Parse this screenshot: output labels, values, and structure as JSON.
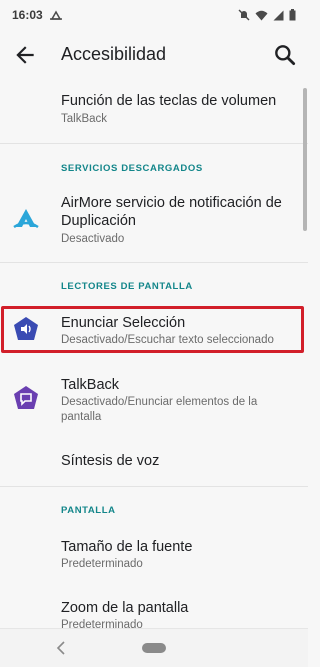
{
  "status_bar": {
    "time": "16:03"
  },
  "app_bar": {
    "title": "Accesibilidad"
  },
  "items": {
    "volume_keys": {
      "title": "Función de las teclas de volumen",
      "subtitle": "TalkBack"
    },
    "airmore": {
      "title_line1": "AirMore servicio de notificación de",
      "title_line2": "Duplicación",
      "subtitle": "Desactivado"
    },
    "enunciar": {
      "title": "Enunciar Selección",
      "subtitle": "Desactivado/Escuchar texto seleccionado"
    },
    "talkback": {
      "title": "TalkBack",
      "subtitle_line1": "Desactivado/Enunciar elementos de la",
      "subtitle_line2": "pantalla"
    },
    "tts": {
      "title": "Síntesis de voz"
    },
    "font_size": {
      "title": "Tamaño de la fuente",
      "subtitle": "Predeterminado"
    },
    "zoom": {
      "title": "Zoom de la pantalla",
      "subtitle": "Predeterminado"
    }
  },
  "sections": {
    "downloaded": "SERVICIOS DESCARGADOS",
    "screen_readers": "LECTORES DE PANTALLA",
    "display": "PANTALLA"
  },
  "icons": {
    "back": "arrow-back-icon",
    "search": "search-icon",
    "airmore": "airmore-icon",
    "enunciar": "speaker-icon",
    "talkback": "talkback-icon"
  },
  "colors": {
    "accent": "#13868a",
    "highlight": "#d21f2a",
    "enunciar_icon": "#3a4bb3",
    "talkback_icon": "#6a3fb1",
    "airmore_icon": "#2ba6d9"
  }
}
